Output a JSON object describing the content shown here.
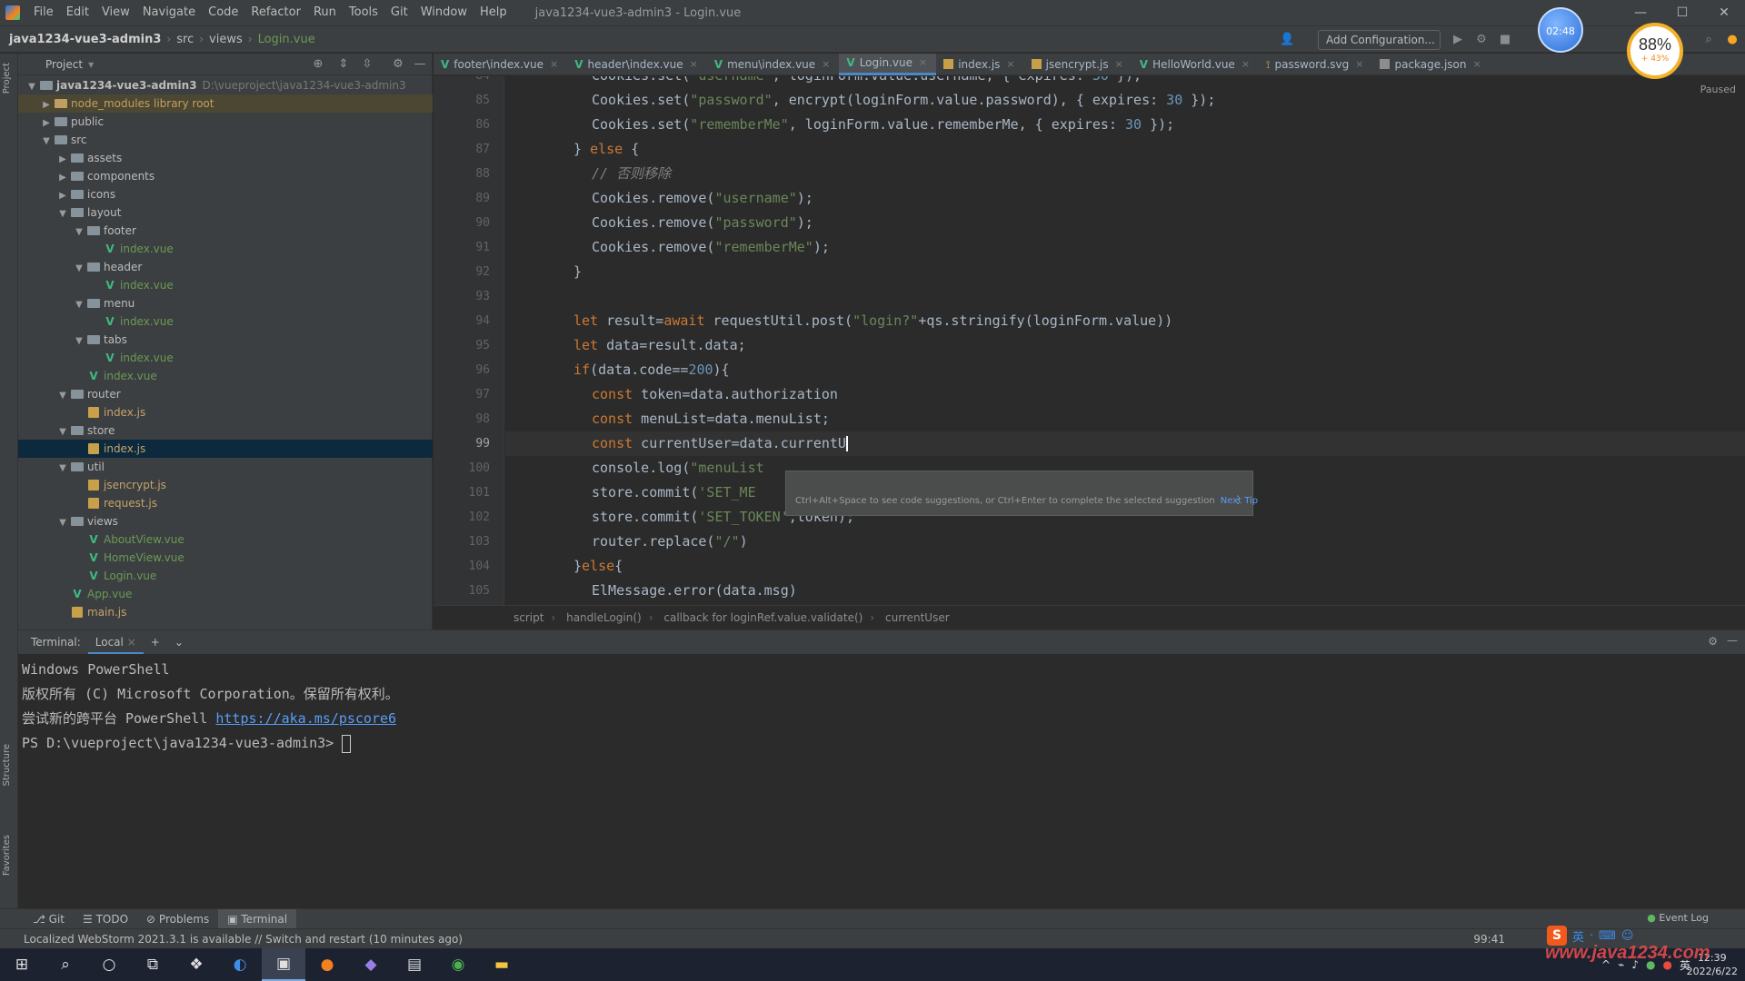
{
  "menubar": {
    "items": [
      "File",
      "Edit",
      "View",
      "Navigate",
      "Code",
      "Refactor",
      "Run",
      "Tools",
      "Git",
      "Window",
      "Help"
    ],
    "title": "java1234-vue3-admin3 - Login.vue"
  },
  "navbar": {
    "project": "java1234-vue3-admin3",
    "crumbs": [
      "src",
      "views",
      "Login.vue"
    ],
    "add_config": "Add Configuration..."
  },
  "project_panel": {
    "title": "Project",
    "tree": [
      {
        "label": "java1234-vue3-admin3",
        "path": "D:\\vueproject\\java1234-vue3-admin3",
        "type": "root"
      },
      {
        "label": "node_modules  library root",
        "type": "folder-excluded"
      },
      {
        "label": "public",
        "type": "folder"
      },
      {
        "label": "src",
        "type": "folder"
      },
      {
        "label": "assets",
        "type": "folder"
      },
      {
        "label": "components",
        "type": "folder"
      },
      {
        "label": "icons",
        "type": "folder"
      },
      {
        "label": "layout",
        "type": "folder"
      },
      {
        "label": "footer",
        "type": "folder"
      },
      {
        "label": "index.vue",
        "type": "vue"
      },
      {
        "label": "header",
        "type": "folder"
      },
      {
        "label": "index.vue",
        "type": "vue"
      },
      {
        "label": "menu",
        "type": "folder"
      },
      {
        "label": "index.vue",
        "type": "vue"
      },
      {
        "label": "tabs",
        "type": "folder"
      },
      {
        "label": "index.vue",
        "type": "vue"
      },
      {
        "label": "index.vue",
        "type": "vue"
      },
      {
        "label": "router",
        "type": "folder"
      },
      {
        "label": "index.js",
        "type": "js"
      },
      {
        "label": "store",
        "type": "folder"
      },
      {
        "label": "index.js",
        "type": "js"
      },
      {
        "label": "util",
        "type": "folder"
      },
      {
        "label": "jsencrypt.js",
        "type": "js"
      },
      {
        "label": "request.js",
        "type": "js"
      },
      {
        "label": "views",
        "type": "folder"
      },
      {
        "label": "AboutView.vue",
        "type": "vue"
      },
      {
        "label": "HomeView.vue",
        "type": "vue"
      },
      {
        "label": "Login.vue",
        "type": "vue"
      },
      {
        "label": "App.vue",
        "type": "vue"
      },
      {
        "label": "main.js",
        "type": "js"
      }
    ]
  },
  "editor_tabs": [
    {
      "label": "footer\\index.vue",
      "icon": "vue"
    },
    {
      "label": "header\\index.vue",
      "icon": "vue"
    },
    {
      "label": "menu\\index.vue",
      "icon": "vue"
    },
    {
      "label": "Login.vue",
      "icon": "vue",
      "active": true
    },
    {
      "label": "index.js",
      "icon": "js"
    },
    {
      "label": "jsencrypt.js",
      "icon": "js"
    },
    {
      "label": "HelloWorld.vue",
      "icon": "vue"
    },
    {
      "label": "password.svg",
      "icon": "svg"
    },
    {
      "label": "package.json",
      "icon": "json"
    }
  ],
  "editor": {
    "reader_mode": "Paused",
    "line_numbers": [
      "84",
      "85",
      "86",
      "87",
      "88",
      "89",
      "90",
      "91",
      "92",
      "93",
      "94",
      "95",
      "96",
      "97",
      "98",
      "99",
      "100",
      "101",
      "102",
      "103",
      "104",
      "105"
    ],
    "current_line": "99",
    "tooltip_text": "Ctrl+Alt+Space to see code suggestions, or Ctrl+Enter to complete the selected suggestion",
    "tooltip_link": "Next Tip"
  },
  "code_breadcrumb": [
    "script",
    "handleLogin()",
    "callback for loginRef.value.validate()",
    "currentUser"
  ],
  "terminal": {
    "title": "Terminal:",
    "tab": "Local",
    "lines": [
      "Windows PowerShell",
      "版权所有 (C) Microsoft Corporation。保留所有权利。",
      "尝试新的跨平台 PowerShell "
    ],
    "link": "https://aka.ms/pscore6",
    "prompt": "PS D:\\vueproject\\java1234-vue3-admin3> "
  },
  "tool_tabs": [
    "Git",
    "TODO",
    "Problems",
    "Terminal"
  ],
  "event_log": "Event Log",
  "status": {
    "message": "Localized WebStorm 2021.3.1 is available // Switch and restart (10 minutes ago)",
    "cursor": "99:41"
  },
  "overlay": {
    "badge": "02:48",
    "speed_pct": "88%",
    "speed_sub": "+ 43%",
    "watermark": "www.java1234.com",
    "ime": [
      "英",
      "·",
      "⌨",
      "☺"
    ]
  },
  "taskbar": {
    "clock_time": "12:39",
    "clock_date": "2022/6/22",
    "tray_lang": "英"
  }
}
